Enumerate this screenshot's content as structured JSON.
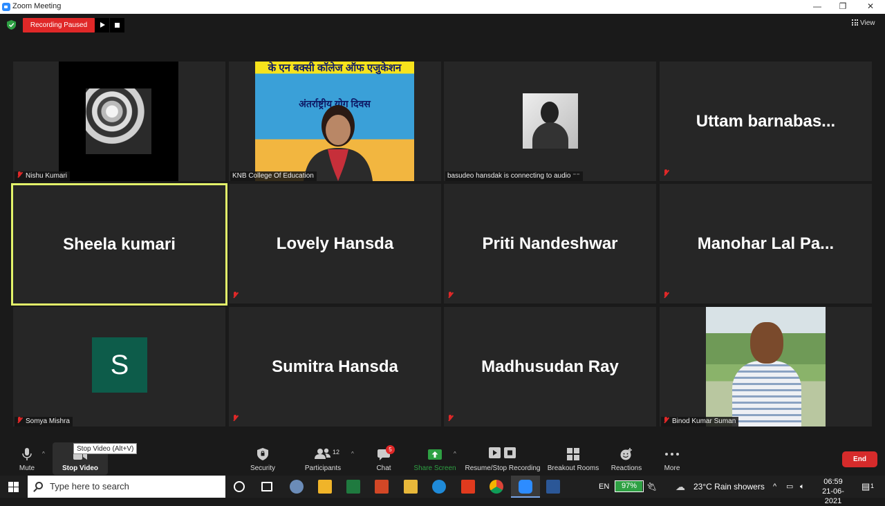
{
  "window": {
    "title": "Zoom Meeting",
    "minimize": "—",
    "maximize": "❐",
    "close": "✕"
  },
  "recording": {
    "status": "Recording Paused"
  },
  "view": {
    "label": "View"
  },
  "banner": {
    "line1": "के एन बक्सी कॉलेज ऑफ एजुकेशन",
    "line2": "अंतर्राष्ट्रीय योग दिवस"
  },
  "tiles": [
    {
      "name": "Nishu Kumari",
      "type": "flower",
      "muted": true
    },
    {
      "name": "KNB College Of Education",
      "type": "video",
      "muted": false
    },
    {
      "name": "basudeo hansdak is connecting to audio",
      "type": "photo",
      "muted": false
    },
    {
      "name": "Uttam  barnabas...",
      "type": "name",
      "muted": true
    },
    {
      "name": "Sheela kumari",
      "type": "name",
      "muted": false,
      "active": true
    },
    {
      "name": "Lovely Hansda",
      "type": "name",
      "muted": true
    },
    {
      "name": "Priti Nandeshwar",
      "type": "name",
      "muted": true
    },
    {
      "name": "Manohar  Lal  Pa...",
      "type": "name",
      "muted": true
    },
    {
      "name": "Somya Mishra",
      "type": "avatar",
      "avatar_letter": "S",
      "muted": true
    },
    {
      "name": "Sumitra Hansda",
      "type": "name",
      "muted": true
    },
    {
      "name": "Madhusudan Ray",
      "type": "name",
      "muted": true
    },
    {
      "name": "Binod Kumar Suman",
      "type": "photo",
      "muted": true
    }
  ],
  "toolbar": {
    "mute": "Mute",
    "stop_video": "Stop Video",
    "tooltip": "Stop Video (Alt+V)",
    "security": "Security",
    "participants": "Participants",
    "participants_count": "12",
    "chat": "Chat",
    "chat_badge": "5",
    "share_screen": "Share Screen",
    "recording": "Resume/Stop Recording",
    "breakout": "Breakout Rooms",
    "reactions": "Reactions",
    "more": "More",
    "end": "End"
  },
  "taskbar": {
    "search_placeholder": "Type here to search",
    "lang": "EN",
    "battery": "97%",
    "weather": "23°C  Rain showers",
    "time": "06:59",
    "date": "21-06-2021",
    "notif": "1"
  },
  "colors": {
    "accent": "#e3f36a",
    "record": "#e02828",
    "share": "#2ea043",
    "end": "#d62b2b"
  }
}
